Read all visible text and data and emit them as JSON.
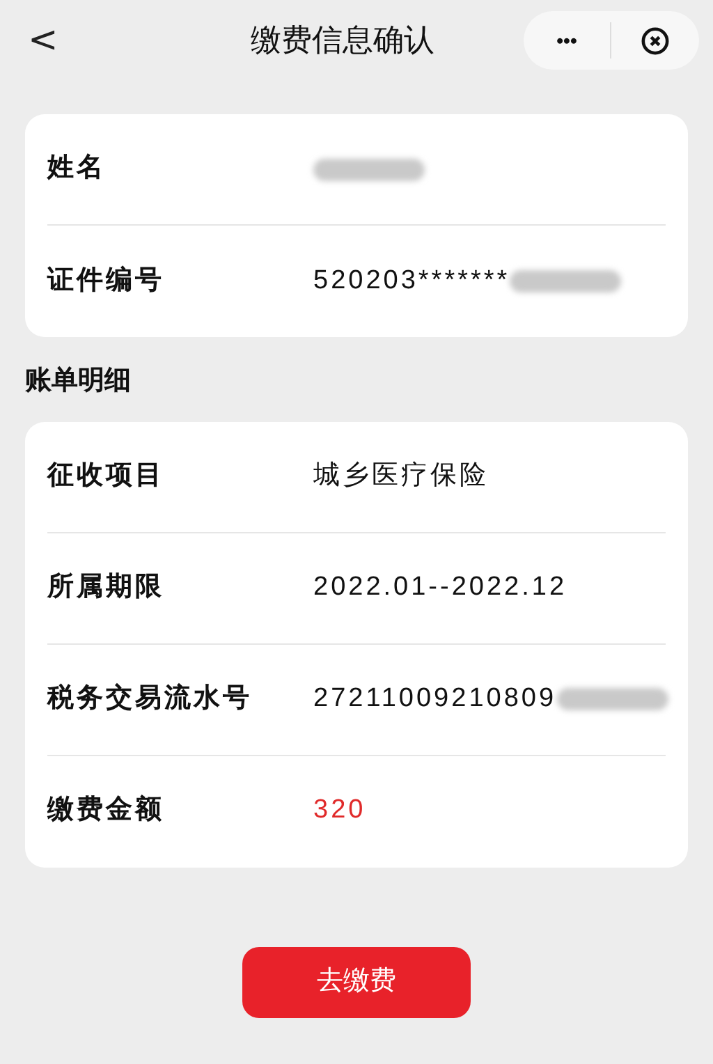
{
  "header": {
    "back": "<",
    "title": "缴费信息确认",
    "more": "•••"
  },
  "info": [
    {
      "label": "姓名",
      "redacted": true
    },
    {
      "label": "证件编号",
      "value": "520203*******",
      "redacted": true
    }
  ],
  "section_title": "账单明细",
  "bill": [
    {
      "label": "征收项目",
      "value": "城乡医疗保险",
      "kind": "text",
      "redacted": false
    },
    {
      "label": "所属期限",
      "value": "2022.01--2022.12",
      "kind": "text",
      "redacted": false
    },
    {
      "label": "税务交易流水号",
      "value": "27211009210809",
      "kind": "text",
      "redacted": true
    },
    {
      "label": "缴费金额",
      "value": "320",
      "kind": "amount",
      "redacted": false
    }
  ],
  "pay_button": "去缴费"
}
